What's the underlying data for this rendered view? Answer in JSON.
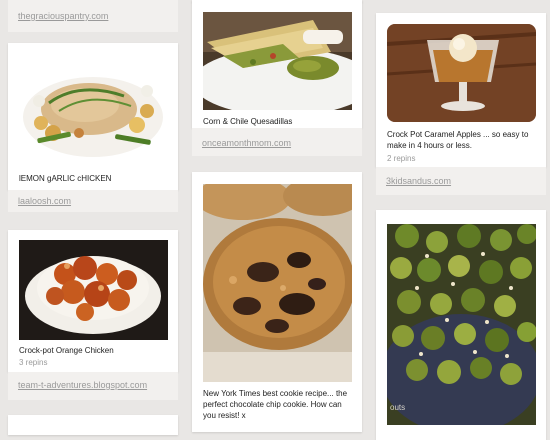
{
  "columns": [
    {
      "pins": [
        {
          "source": "thegraciouspantry.com"
        },
        {
          "caption": "lEMON gARLIC cHICKEN",
          "source": "laaloosh.com",
          "image": "lemon-garlic-chicken-image"
        },
        {
          "caption": "Crock-pot Orange Chicken",
          "repins": "3 repins",
          "source": "team-t-adventures.blogspot.com",
          "image": "orange-chicken-image"
        }
      ]
    },
    {
      "pins": [
        {
          "caption": "Corn & Chile Quesadillas",
          "source": "onceamonthmom.com",
          "image": "quesadilla-image"
        },
        {
          "caption": "New York Times best cookie recipe... the perfect chocolate chip cookie. How can you resist! x",
          "image": "cookie-image"
        }
      ]
    },
    {
      "pins": [
        {
          "caption": "Crock Pot Caramel Apples ... so easy to make in 4 hours or less.",
          "repins": "2 repins",
          "source": "3kidsandus.com",
          "image": "caramel-apple-image"
        },
        {
          "watermark": "outs",
          "image": "brussels-sprouts-image"
        }
      ]
    }
  ],
  "colors": {
    "background": "#e9e7e5",
    "card": "#ffffff",
    "footer": "#f2f0ee",
    "link": "#9a9a9a"
  }
}
